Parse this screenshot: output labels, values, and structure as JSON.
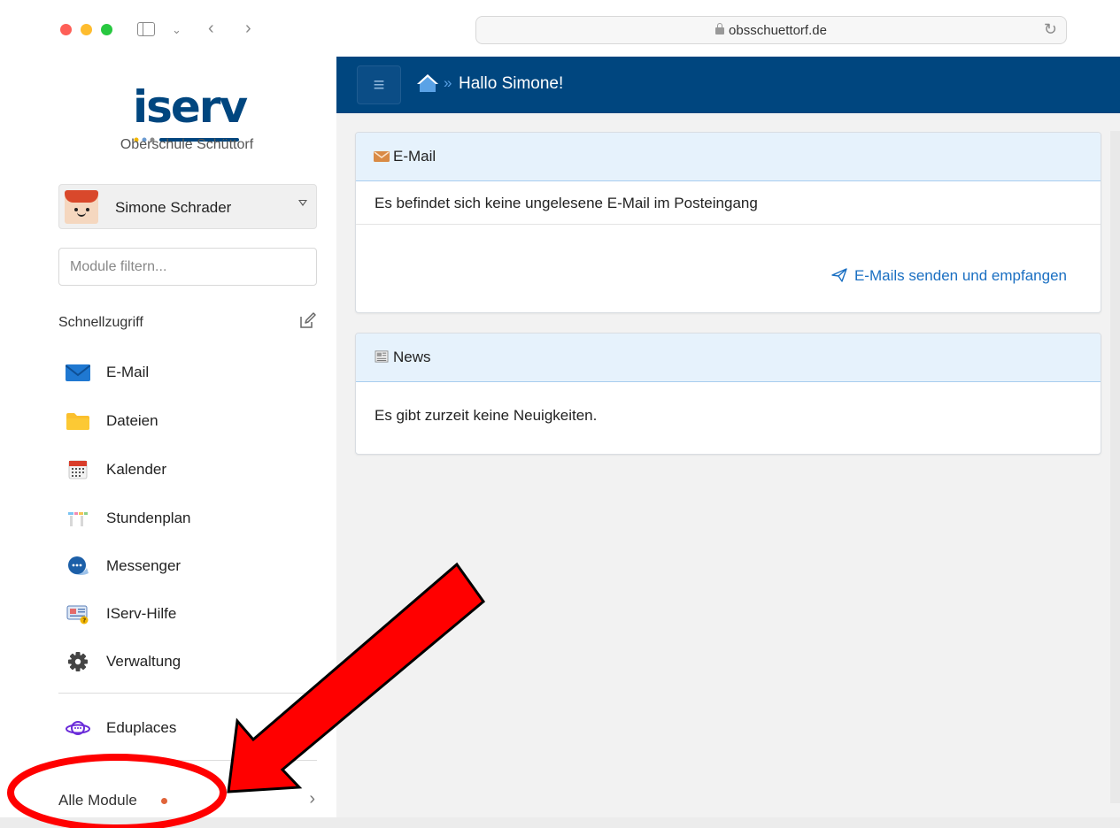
{
  "browser": {
    "url": "obsschuettorf.de"
  },
  "brand": {
    "logo_text": "iserv",
    "school_name": "Oberschule Schüttorf"
  },
  "user": {
    "name": "Simone Schrader"
  },
  "filter": {
    "placeholder": "Module filtern..."
  },
  "quick_access": {
    "title": "Schnellzugriff",
    "items": [
      {
        "label": "E-Mail",
        "icon": "envelope-icon"
      },
      {
        "label": "Dateien",
        "icon": "folder-icon"
      },
      {
        "label": "Kalender",
        "icon": "calendar-icon"
      },
      {
        "label": "Stundenplan",
        "icon": "timetable-icon"
      },
      {
        "label": "Messenger",
        "icon": "chat-bubble-icon"
      },
      {
        "label": "IServ-Hilfe",
        "icon": "help-icon"
      },
      {
        "label": "Verwaltung",
        "icon": "gear-icon"
      }
    ],
    "extra": {
      "label": "Eduplaces",
      "icon": "planet-icon"
    }
  },
  "all_modules": {
    "label": "Alle Module"
  },
  "header": {
    "separator": "»",
    "title": "Hallo Simone!"
  },
  "email_card": {
    "title": "E-Mail",
    "message": "Es befindet sich keine ungelesene E-Mail im Posteingang",
    "link": "E-Mails senden und empfangen"
  },
  "news_card": {
    "title": "News",
    "message": "Es gibt zurzeit keine Neuigkeiten."
  },
  "colors": {
    "header_blue": "#00467f",
    "link_blue": "#1a6fc2",
    "annotation_red": "#ff0000",
    "notification_dot": "#e0643a"
  }
}
